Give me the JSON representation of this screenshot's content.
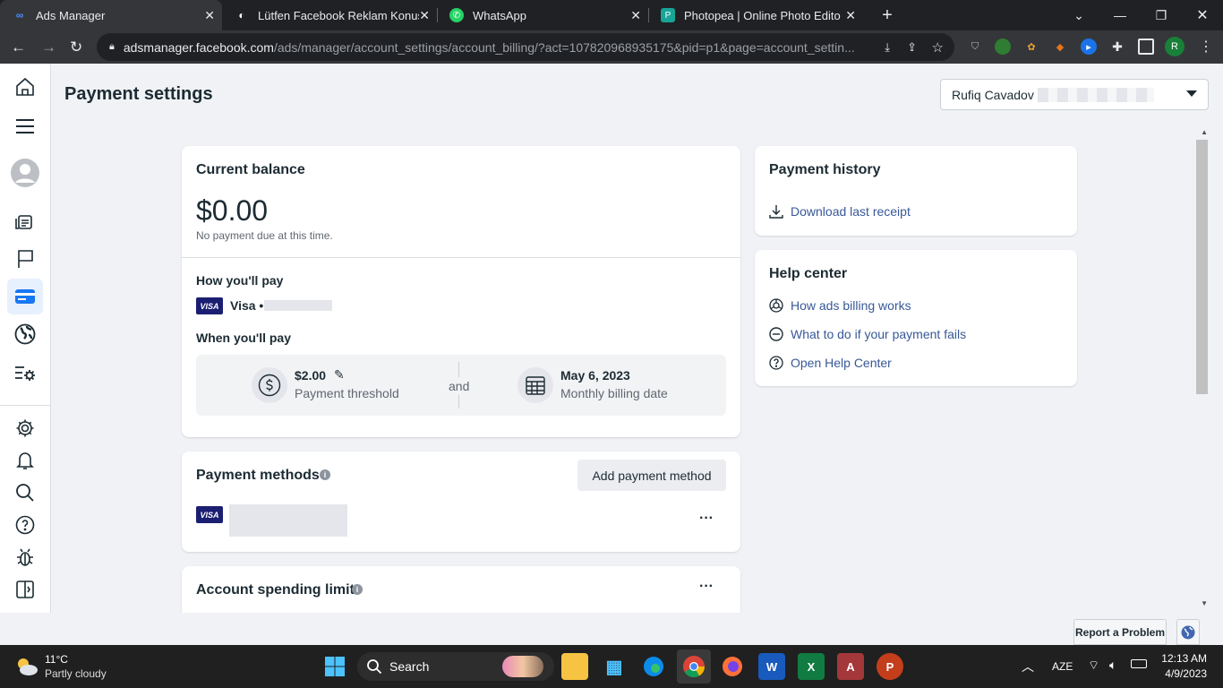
{
  "browser": {
    "tabs": [
      {
        "title": "Ads Manager"
      },
      {
        "title": "Lütfen Facebook Reklam Konusun"
      },
      {
        "title": "WhatsApp"
      },
      {
        "title": "Photopea | Online Photo Editor"
      }
    ],
    "url_host": "adsmanager.facebook.com",
    "url_path": "/ads/manager/account_settings/account_billing/?act=107820968935175&pid=p1&page=account_settin...",
    "profile_initial": "R"
  },
  "page": {
    "title": "Payment settings",
    "account_name": "Rufiq Cavadov"
  },
  "balance": {
    "heading": "Current balance",
    "amount": "$0.00",
    "note": "No payment due at this time.",
    "how_heading": "How you'll pay",
    "card_brand": "VISA",
    "card_label": "Visa •",
    "when_heading": "When you'll pay",
    "threshold_value": "$2.00",
    "threshold_label": "Payment threshold",
    "and": "and",
    "date_value": "May 6, 2023",
    "date_label": "Monthly billing date"
  },
  "payment_methods": {
    "heading": "Payment methods",
    "add_button": "Add payment method",
    "card_brand": "VISA",
    "more": "···"
  },
  "spending_limit": {
    "heading": "Account spending limit",
    "more": "···"
  },
  "payment_history": {
    "heading": "Payment history",
    "download": "Download last receipt"
  },
  "help_center": {
    "heading": "Help center",
    "links": [
      {
        "label": "How ads billing works"
      },
      {
        "label": "What to do if your payment fails"
      },
      {
        "label": "Open Help Center"
      }
    ]
  },
  "footer": {
    "report": "Report a Problem"
  },
  "taskbar": {
    "weather_temp": "11°C",
    "weather_desc": "Partly cloudy",
    "search": "Search",
    "lang": "AZE",
    "time": "12:13 AM",
    "date": "4/9/2023"
  },
  "colors": {
    "accent": "#1877f2",
    "link": "#385898",
    "visa": "#1a1f71"
  }
}
